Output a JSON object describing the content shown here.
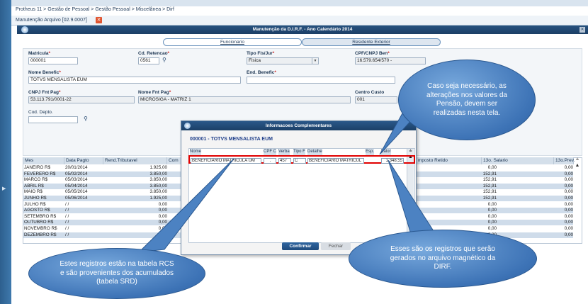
{
  "breadcrumb": "Protheus 11 > Gestão de Pessoal > Gestão Pessoal > Miscelânea > Dirf",
  "window_tab": "Manutenção Arquivo [02.9.0007]",
  "tab_close": "✕",
  "dialog": {
    "title": "Manutenção da D.I.R.F. - Ano Calendário 2014",
    "close": "✕"
  },
  "folders": {
    "funcionario": "Funcionario",
    "residente": "Residente Exterior"
  },
  "form": {
    "matricula": {
      "label": "Matricula",
      "value": "000001"
    },
    "cd_retencao": {
      "label": "Cd. Retencao",
      "value": "0561"
    },
    "tipo_fis_jur": {
      "label": "Tipo Fis/Jur",
      "value": "Fisica"
    },
    "cpf_cnpj": {
      "label": "CPF/CNPJ Ben",
      "value": "16.579.654/570 -"
    },
    "nome_benefic": {
      "label": "Nome Benefic",
      "value": "TOTVS  MENSALISTA EUM"
    },
    "end_benefic": {
      "label": "End. Benefic",
      "value": ""
    },
    "cnpj_fnt": {
      "label": "CNPJ Fnt Pag",
      "value": "53.113.791/0001-22"
    },
    "nome_fnt": {
      "label": "Nome Fnt Pag",
      "value": "MICROSIGA - MATRIZ 1"
    },
    "centro_custo": {
      "label": "Centro Custo",
      "value": "001"
    },
    "cod_depto": {
      "label": "Cod. Depto.",
      "value": ""
    },
    "required_mark": "*"
  },
  "grid": {
    "headers": {
      "mes": "Mes",
      "data": "Data Pagto",
      "rend": "Rend.Tributavel",
      "com": "Com",
      "imposto": "mposto Retido",
      "salario13": "13o. Salario",
      "prev13": "13o.Prev."
    },
    "rows": [
      {
        "mes": "JANEIRO   R$",
        "data": "20/01/2014",
        "rend": "1.925,00",
        "imp": "0,00",
        "sal": "0,00"
      },
      {
        "mes": "FEVERERO R$",
        "data": "05/02/2014",
        "rend": "3.850,00",
        "imp": "152,91",
        "sal": "0,00"
      },
      {
        "mes": "MARCO     R$",
        "data": "05/03/2014",
        "rend": "3.850,00",
        "imp": "152,91",
        "sal": "0,00"
      },
      {
        "mes": "ABRIL     R$",
        "data": "05/04/2014",
        "rend": "3.850,00",
        "imp": "152,91",
        "sal": "0,00"
      },
      {
        "mes": "MAIO      R$",
        "data": "05/05/2014",
        "rend": "3.850,00",
        "imp": "152,91",
        "sal": "0,00"
      },
      {
        "mes": "JUNHO     R$",
        "data": "05/06/2014",
        "rend": "1.925,00",
        "imp": "152,91",
        "sal": "0,00"
      },
      {
        "mes": "JULHO     R$",
        "data": " / /",
        "rend": "0,00",
        "imp": "0,00",
        "sal": "0,00"
      },
      {
        "mes": "AGOSTO   R$",
        "data": " / /",
        "rend": "0,00",
        "imp": "0,00",
        "sal": "0,00"
      },
      {
        "mes": "SETEMBRO R$",
        "data": " / /",
        "rend": "0,00",
        "imp": "0,00",
        "sal": "0,00"
      },
      {
        "mes": "OUTUBRO  R$",
        "data": " / /",
        "rend": "0,00",
        "imp": "0,00",
        "sal": "0,00"
      },
      {
        "mes": "NOVEMBRO R$",
        "data": " / /",
        "rend": "0,00",
        "imp": "0,00",
        "sal": "0,00"
      },
      {
        "mes": "DEZEMBRO R$",
        "data": " / /",
        "rend": "0,00",
        "imp": "0,00",
        "sal": "0,00"
      }
    ]
  },
  "popup": {
    "title": "Informacoes Complementares",
    "subtitle": "000001 - TOTVS  MENSALISTA EUM",
    "headers": {
      "nome": "Nome",
      "cpf": "CPF C",
      "verba": "Verba",
      "tipo": "Tipo F",
      "detalhe": "Detalhe",
      "esp": "Esp.",
      "valor": "Valor"
    },
    "row": {
      "nome": "BENEFICIARIO MATRICULA UM",
      "cpf": ".",
      "verba": "457",
      "tipo": "C",
      "detalhe": "BENEFICIARIO MATRICUL",
      "valor": "1.348,55"
    },
    "confirm": "Confirmar",
    "close": "Fechar"
  },
  "callouts": {
    "top": "Caso seja necessário, as alterações nos valores da Pensão, devem ser realizadas nesta tela.",
    "bottom_left": "Estes registros estão na tabela RCS e são provenientes dos acumulados (tabela SRD)",
    "bottom_right": "Esses são os registros que serão gerados no arquivo magnético da DIRF."
  }
}
